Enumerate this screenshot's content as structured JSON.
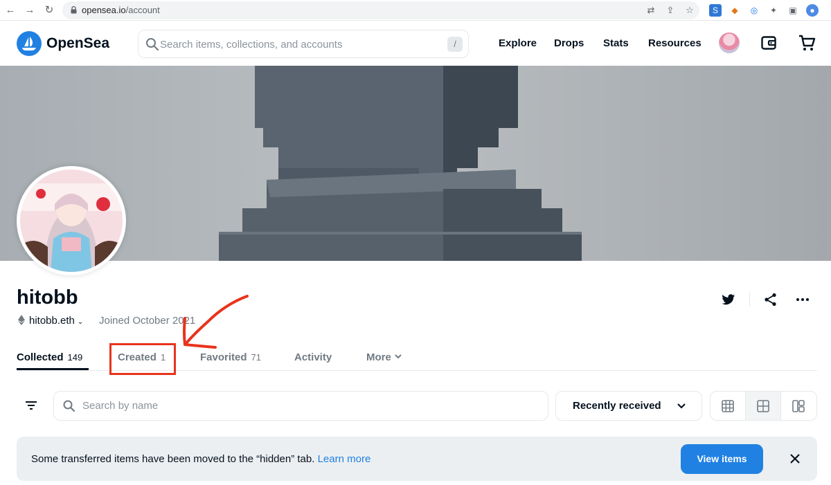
{
  "browser": {
    "url_domain": "opensea.io",
    "url_path": "/account"
  },
  "header": {
    "brand": "OpenSea",
    "search_placeholder": "Search items, collections, and accounts",
    "search_shortcut": "/",
    "nav": [
      "Explore",
      "Drops",
      "Stats",
      "Resources"
    ]
  },
  "profile": {
    "username": "hitobb",
    "ens": "hitobb.eth",
    "joined": "Joined October 2021"
  },
  "tabs": [
    {
      "label": "Collected",
      "count": "149"
    },
    {
      "label": "Created",
      "count": "1"
    },
    {
      "label": "Favorited",
      "count": "71"
    },
    {
      "label": "Activity",
      "count": ""
    },
    {
      "label": "More",
      "count": ""
    }
  ],
  "filters": {
    "name_search_placeholder": "Search by name",
    "sort_label": "Recently received"
  },
  "notice": {
    "message": "Some transferred items have been moved to the “hidden” tab.",
    "link": "Learn more",
    "button": "View items"
  },
  "colors": {
    "accent": "#2081e2",
    "annotation": "#e8331c",
    "text": "#04111d",
    "muted": "#707a83"
  }
}
